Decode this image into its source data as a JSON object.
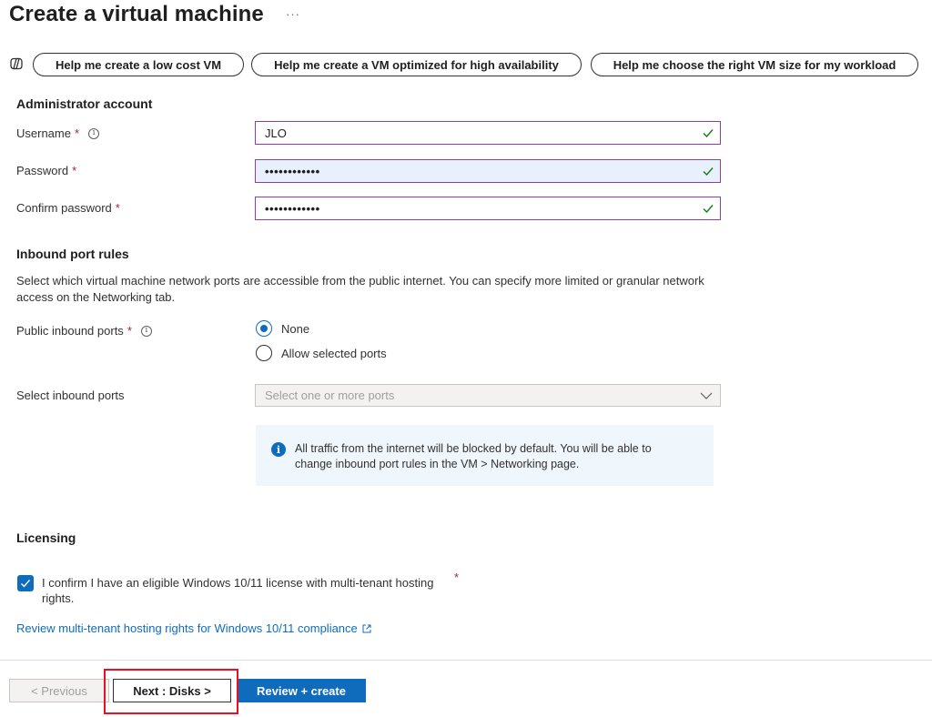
{
  "header": {
    "title": "Create a virtual machine",
    "more": "···"
  },
  "copilot": {
    "pills": [
      "Help me create a low cost VM",
      "Help me create a VM optimized for high availability",
      "Help me choose the right VM size for my workload"
    ]
  },
  "admin": {
    "heading": "Administrator account",
    "username_label": "Username",
    "username_value": "JLO",
    "password_label": "Password",
    "password_value": "••••••••••••",
    "confirm_label": "Confirm password",
    "confirm_value": "••••••••••••",
    "required_mark": "*"
  },
  "inbound": {
    "heading": "Inbound port rules",
    "description": "Select which virtual machine network ports are accessible from the public internet. You can specify more limited or granular network access on the Networking tab.",
    "public_label": "Public inbound ports",
    "options": [
      "None",
      "Allow selected ports"
    ],
    "selected_option": "None",
    "select_label": "Select inbound ports",
    "select_placeholder": "Select one or more ports",
    "info_text": "All traffic from the internet will be blocked by default. You will be able to change inbound port rules in the VM > Networking page."
  },
  "licensing": {
    "heading": "Licensing",
    "checkbox_text": "I confirm I have an eligible Windows 10/11 license with multi-tenant hosting rights.",
    "checked": true,
    "link_text": "Review multi-tenant hosting rights for Windows 10/11 compliance"
  },
  "footer": {
    "prev_label": "< Previous",
    "next_label": "Next : Disks >",
    "review_label": "Review + create"
  },
  "colors": {
    "accent": "#0f6cbd",
    "valid_border": "#8a3ea6",
    "required": "#a4262c",
    "highlight": "#e81123"
  }
}
